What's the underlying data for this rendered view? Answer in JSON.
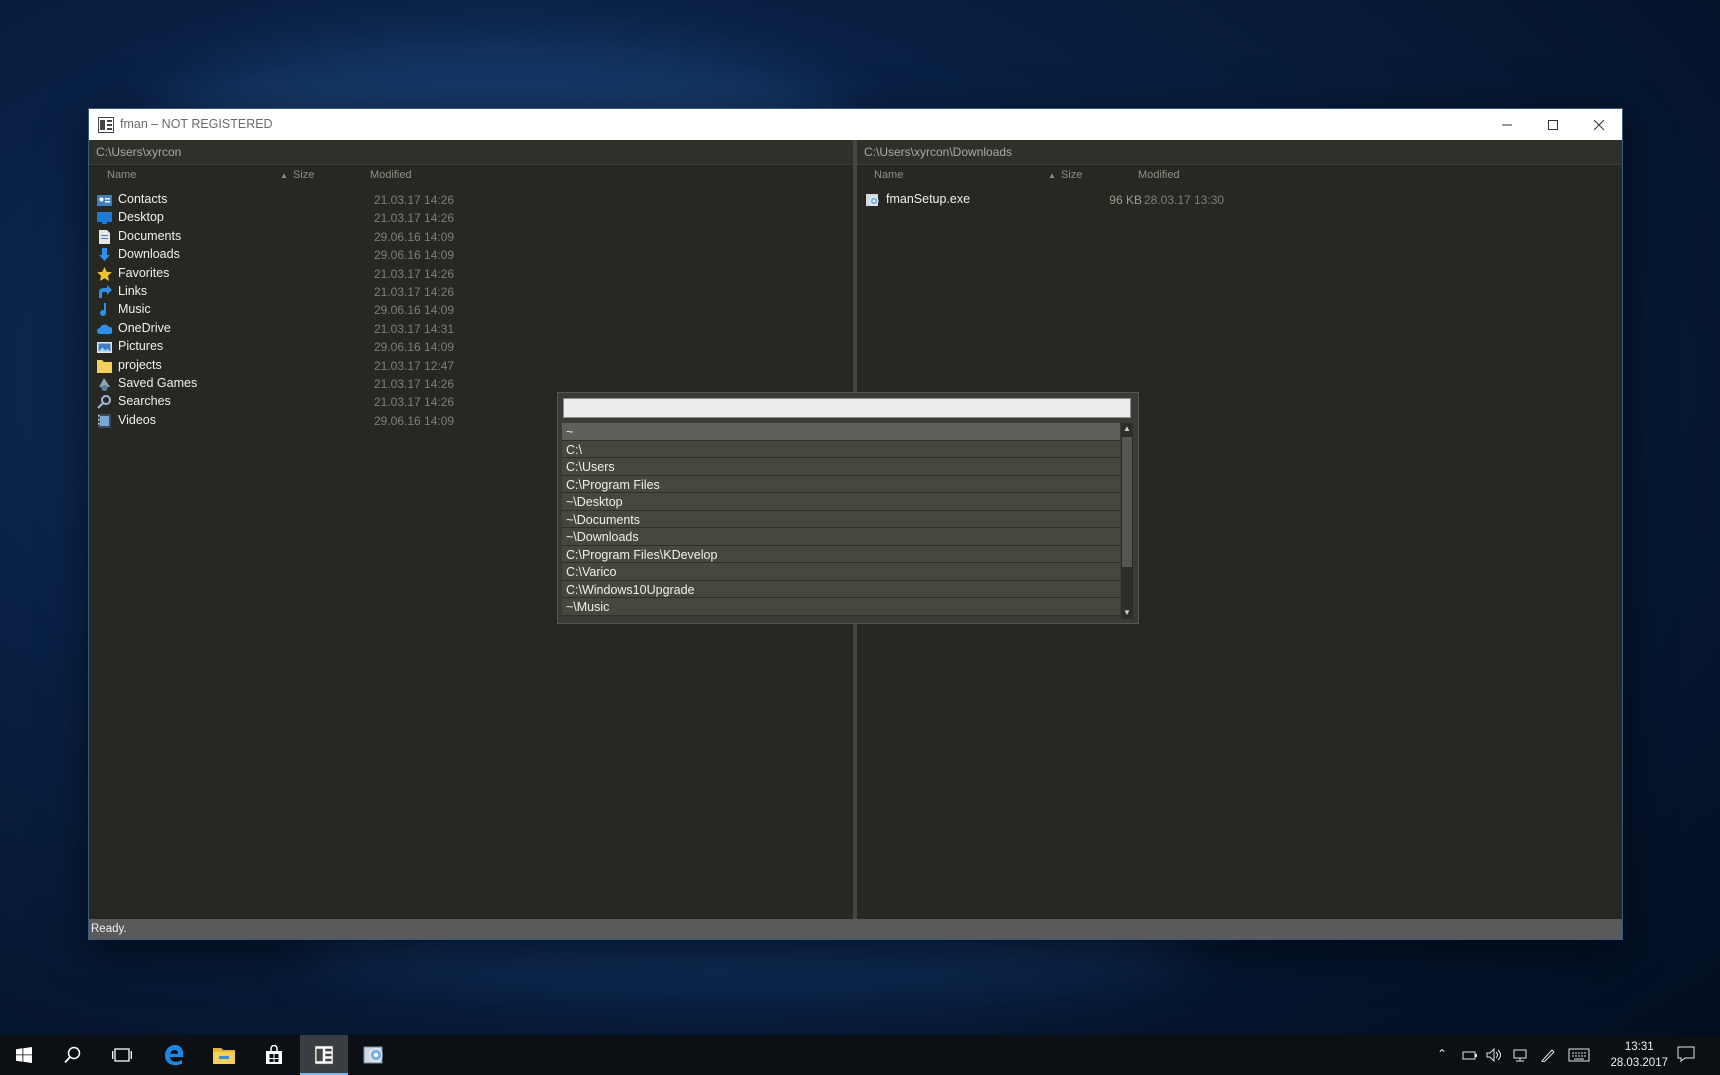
{
  "window": {
    "title": "fman – NOT REGISTERED",
    "controls": {
      "minimize": "—",
      "maximize": "☐",
      "close": "✕"
    }
  },
  "left_pane": {
    "path": "C:\\Users\\xyrcon",
    "columns": {
      "name": "Name",
      "size": "Size",
      "modified": "Modified",
      "sort_indicator": "▲"
    },
    "files": [
      {
        "name": "Contacts",
        "size": "",
        "modified": "21.03.17 14:26",
        "icon": "contacts-icon"
      },
      {
        "name": "Desktop",
        "size": "",
        "modified": "21.03.17 14:26",
        "icon": "desktop-icon"
      },
      {
        "name": "Documents",
        "size": "",
        "modified": "29.06.16 14:09",
        "icon": "documents-icon"
      },
      {
        "name": "Downloads",
        "size": "",
        "modified": "29.06.16 14:09",
        "icon": "downloads-icon"
      },
      {
        "name": "Favorites",
        "size": "",
        "modified": "21.03.17 14:26",
        "icon": "favorites-icon"
      },
      {
        "name": "Links",
        "size": "",
        "modified": "21.03.17 14:26",
        "icon": "links-icon"
      },
      {
        "name": "Music",
        "size": "",
        "modified": "29.06.16 14:09",
        "icon": "music-icon"
      },
      {
        "name": "OneDrive",
        "size": "",
        "modified": "21.03.17 14:31",
        "icon": "onedrive-icon"
      },
      {
        "name": "Pictures",
        "size": "",
        "modified": "29.06.16 14:09",
        "icon": "pictures-icon"
      },
      {
        "name": "projects",
        "size": "",
        "modified": "21.03.17 12:47",
        "icon": "folder-icon"
      },
      {
        "name": "Saved Games",
        "size": "",
        "modified": "21.03.17 14:26",
        "icon": "saved-games-icon"
      },
      {
        "name": "Searches",
        "size": "",
        "modified": "21.03.17 14:26",
        "icon": "searches-icon"
      },
      {
        "name": "Videos",
        "size": "",
        "modified": "29.06.16 14:09",
        "icon": "videos-icon"
      }
    ]
  },
  "right_pane": {
    "path": "C:\\Users\\xyrcon\\Downloads",
    "columns": {
      "name": "Name",
      "size": "Size",
      "modified": "Modified",
      "sort_indicator": "▲"
    },
    "files": [
      {
        "name": "fmanSetup.exe",
        "size": "96 KB",
        "modified": "28.03.17 13:30",
        "icon": "installer-icon"
      }
    ]
  },
  "quick_nav": {
    "input_value": "",
    "items": [
      "~",
      "C:\\",
      "C:\\Users",
      "C:\\Program Files",
      "~\\Desktop",
      "~\\Documents",
      "~\\Downloads",
      "C:\\Program Files\\KDevelop",
      "C:\\Varico",
      "C:\\Windows10Upgrade",
      "~\\Music"
    ],
    "selected_index": 0,
    "scroll_up": "▲",
    "scroll_down": "▼"
  },
  "status": {
    "text": "Ready."
  },
  "taskbar": {
    "apps": [
      {
        "name": "start-button",
        "icon": "windows-logo-icon"
      },
      {
        "name": "search-button",
        "icon": "search-icon"
      },
      {
        "name": "task-view-button",
        "icon": "task-view-icon"
      },
      {
        "name": "edge-app",
        "icon": "edge-icon"
      },
      {
        "name": "file-explorer-app",
        "icon": "folder-icon"
      },
      {
        "name": "store-app",
        "icon": "store-icon"
      },
      {
        "name": "fman-app",
        "icon": "fman-icon"
      },
      {
        "name": "installer-app",
        "icon": "installer-icon"
      }
    ],
    "clock": {
      "time": "13:31",
      "date": "28.03.2017"
    }
  },
  "colors": {
    "pane_bg": "#272822",
    "accent": "#7ab6f0",
    "taskbar": "#0c0f14"
  }
}
